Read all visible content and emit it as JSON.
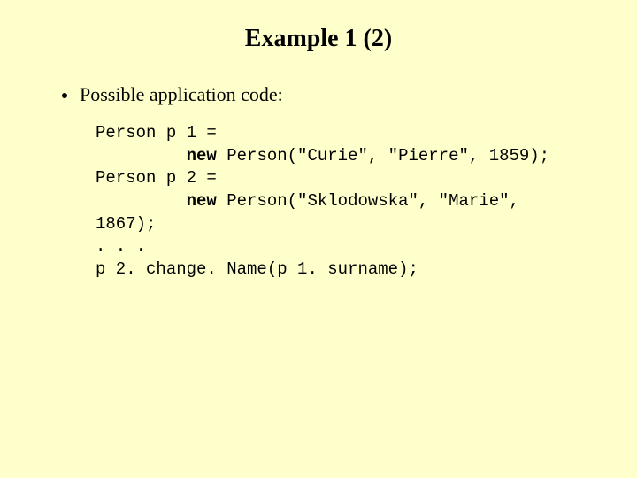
{
  "title": "Example 1 (2)",
  "bullet": "Possible application code:",
  "code": {
    "l1a": "Person p 1 = ",
    "l2_indent": "         ",
    "kw_new": "new",
    "l2b": " Person(\"Curie\", \"Pierre\", 1859);",
    "l3a": "Person p 2 = ",
    "l4b": " Person(\"Sklodowska\", \"Marie\", ",
    "l5": "1867);",
    "l6": ". . .",
    "l7": "p 2. change. Name(p 1. surname);"
  }
}
